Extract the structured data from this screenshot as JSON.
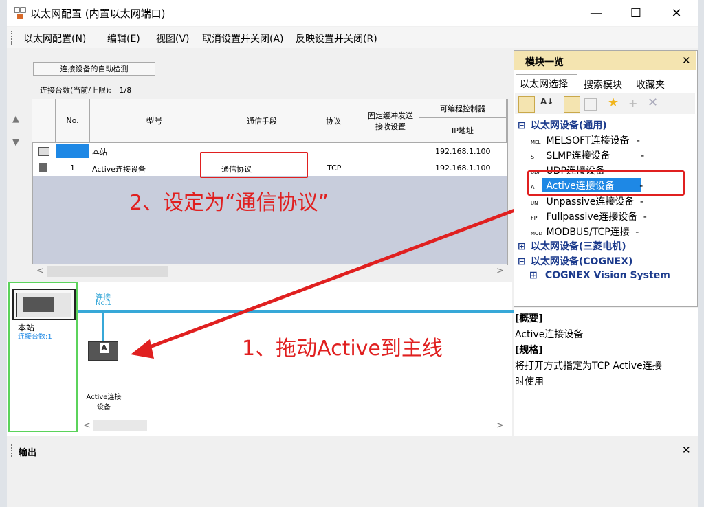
{
  "window": {
    "title": "以太网配置 (内置以太网端口)",
    "minimize": "—",
    "maximize": "☐",
    "close": "✕"
  },
  "menu": {
    "items": [
      "以太网配置(N)",
      "编辑(E)",
      "视图(V)",
      "取消设置并关闭(A)",
      "反映设置并关闭(R)"
    ]
  },
  "upper": {
    "auto_detect": "连接设备的自动检测",
    "count_label": "连接台数(当前/上限):",
    "count_value": "1/8",
    "headers": {
      "no": "No.",
      "model": "型号",
      "comm_method": "通信手段",
      "protocol": "协议",
      "fixed_buffer": "固定缓冲发送接收设置",
      "plc": "可编程控制器",
      "ip": "IP地址"
    },
    "rows": [
      {
        "no": "",
        "model": "本站",
        "comm": "",
        "protocol": "",
        "ip": "192.168.1.100"
      },
      {
        "no": "1",
        "model": "Active连接设备",
        "comm": "通信协议",
        "protocol": "TCP",
        "ip": "192.168.1.100"
      }
    ]
  },
  "annotations": {
    "step2": "2、设定为“通信协议”",
    "step1": "1、拖动Active到主线"
  },
  "diagram": {
    "station_label": "本站",
    "station_count": "连接台数:1",
    "link_label": "连接",
    "link_no": "No.1",
    "device_label_1": "Active连接",
    "device_label_2": "设备"
  },
  "module_panel": {
    "title": "模块一览",
    "close": "✕",
    "tabs": [
      "以太网选择",
      "搜索模块",
      "收藏夹"
    ],
    "tree": {
      "group_general": "以太网设备(通用)",
      "items": [
        {
          "label": "MELSOFT连接设备",
          "suffix": "-"
        },
        {
          "label": "SLMP连接设备",
          "suffix": "-"
        },
        {
          "label": "UDP连接设备",
          "suffix": "-"
        },
        {
          "label": "Active连接设备",
          "suffix": "-"
        },
        {
          "label": "Unpassive连接设备",
          "suffix": "-"
        },
        {
          "label": "Fullpassive连接设备",
          "suffix": "-"
        },
        {
          "label": "MODBUS/TCP连接",
          "suffix": "-"
        }
      ],
      "group_mitsubishi": "以太网设备(三菱电机)",
      "group_cognex": "以太网设备(COGNEX)",
      "cognex_child": "COGNEX Vision System"
    },
    "icon_labels": [
      "MEL",
      "S",
      "UDP",
      "A",
      "UN",
      "FP",
      "MOD"
    ]
  },
  "description": {
    "overview_title": "[概要]",
    "overview_text": "Active连接设备",
    "spec_title": "[规格]",
    "spec_text_1": "将打开方式指定为TCP Active连接",
    "spec_text_2": "时使用"
  },
  "output": {
    "title": "输出",
    "close": "✕"
  },
  "colors": {
    "accent_blue": "#37a8d8",
    "annotation_red": "#e02020",
    "selection_blue": "#1e88e5",
    "highlight_green": "#5bd35b"
  }
}
